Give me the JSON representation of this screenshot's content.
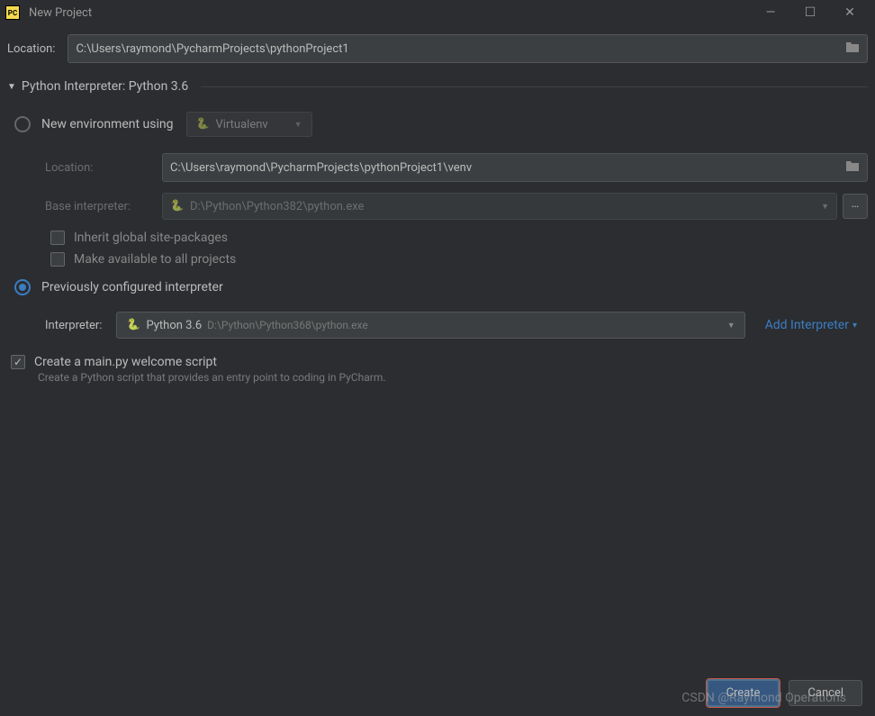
{
  "window": {
    "title": "New Project"
  },
  "location": {
    "label": "Location:",
    "value": "C:\\Users\\raymond\\PycharmProjects\\pythonProject1"
  },
  "interpreter_section": {
    "header": "Python Interpreter: Python 3.6"
  },
  "new_env": {
    "label": "New environment using",
    "dropdown": "Virtualenv",
    "location_label": "Location:",
    "location_value": "C:\\Users\\raymond\\PycharmProjects\\pythonProject1\\venv",
    "base_label": "Base interpreter:",
    "base_value": "D:\\Python\\Python382\\python.exe",
    "inherit": "Inherit global site-packages",
    "make_avail": "Make available to all projects"
  },
  "prev_conf": {
    "label": "Previously configured interpreter",
    "interp_label": "Interpreter:",
    "interp_name": "Python 3.6",
    "interp_path": "D:\\Python\\Python368\\python.exe",
    "add_label": "Add Interpreter"
  },
  "main_script": {
    "label": "Create a main.py welcome script",
    "hint": "Create a Python script that provides an entry point to coding in PyCharm."
  },
  "buttons": {
    "create": "Create",
    "cancel": "Cancel"
  },
  "watermark": "CSDN @Raymond Operations"
}
